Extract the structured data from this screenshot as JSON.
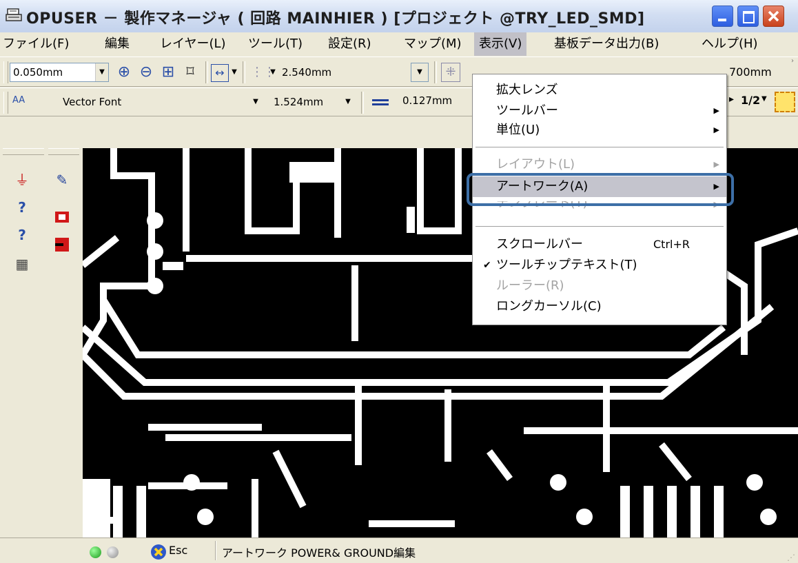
{
  "window": {
    "title": "OPUSER － 製作マネージャ ( 回路 MAINHIER ) [プロジェクト @TRY_LED_SMD]"
  },
  "menubar": {
    "items": [
      {
        "label": "ファイル(F)"
      },
      {
        "label": "編集"
      },
      {
        "label": "レイヤー(L)"
      },
      {
        "label": "ツール(T)"
      },
      {
        "label": "設定(R)"
      },
      {
        "label": "マップ(M)"
      },
      {
        "label": "表示(V)"
      },
      {
        "label": "基板データ出力(B)"
      },
      {
        "label": "ヘルプ(H)"
      }
    ]
  },
  "toolbar1": {
    "grid_combo": "0.050mm",
    "snap_combo": "2.540mm",
    "right_value": "700mm"
  },
  "toolbar2": {
    "font_icon": "AA",
    "font_combo": "Vector Font",
    "size_combo": "1.524mm",
    "width_value": "0.127mm",
    "fraction": "1/2"
  },
  "view_menu": {
    "items": [
      {
        "label": "拡大レンズ",
        "submenu": false,
        "disabled": false
      },
      {
        "label": "ツールバー",
        "submenu": true,
        "disabled": false
      },
      {
        "label": "単位(U)",
        "submenu": true,
        "disabled": false
      },
      {
        "label": "レイアウト(L)",
        "submenu": true,
        "disabled": true
      },
      {
        "label": "アートワーク(A)",
        "submenu": true,
        "disabled": false,
        "highlighted": true
      },
      {
        "label": "テンプレート(T)",
        "submenu": true,
        "disabled": true
      },
      {
        "label": "スクロールバー",
        "shortcut": "Ctrl+R",
        "disabled": false
      },
      {
        "label": "ツールチップテキスト(T)",
        "checked": true,
        "disabled": false
      },
      {
        "label": "ルーラー(R)",
        "disabled": true
      },
      {
        "label": "ロングカーソル(C)",
        "disabled": false
      }
    ]
  },
  "statusbar": {
    "esc_label": "Esc",
    "message": "アートワーク POWER& GROUND編集"
  },
  "colors": {
    "highlight_border": "#3d6fa7",
    "canvas_bg": "#000000",
    "trace": "#ffffff",
    "menu_active": "#c1c0c7"
  },
  "icons": [
    "app-printer-icon",
    "minimize-icon",
    "maximize-icon",
    "close-icon",
    "zoom-in-icon",
    "zoom-out-icon",
    "zoom-window-icon",
    "fit-icon",
    "grid-icon",
    "line-width-icon",
    "esc-icon",
    "led-green-icon",
    "led-gray-icon"
  ]
}
